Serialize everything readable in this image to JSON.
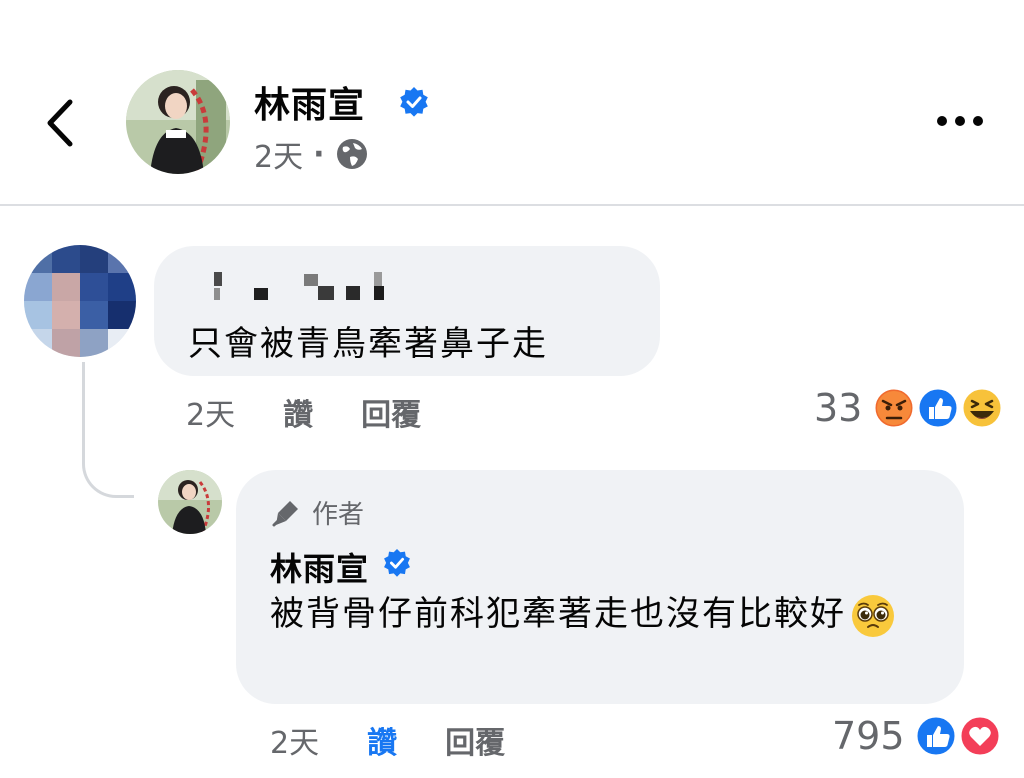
{
  "post": {
    "author": "林雨宣",
    "time": "2天",
    "separator": "·",
    "privacy_icon": "globe-icon"
  },
  "comments": [
    {
      "author_name": "(redacted)",
      "text": "只會被青鳥牽著鼻子走",
      "time": "2天",
      "like_label": "讚",
      "reply_label": "回覆",
      "reaction_count": "33",
      "reactions": [
        "angry",
        "like",
        "haha"
      ]
    },
    {
      "author_badge": "作者",
      "author": "林雨宣",
      "text": "被背骨仔前科犯牽著走也沒有比較好",
      "emoji": "pleading-face",
      "time": "2天",
      "like_label": "讚",
      "liked": true,
      "reply_label": "回覆",
      "reaction_count": "795",
      "reactions": [
        "like",
        "love"
      ]
    }
  ],
  "colors": {
    "accent": "#1877f2",
    "bubble": "#f0f2f5",
    "secondary_text": "#65676b"
  }
}
